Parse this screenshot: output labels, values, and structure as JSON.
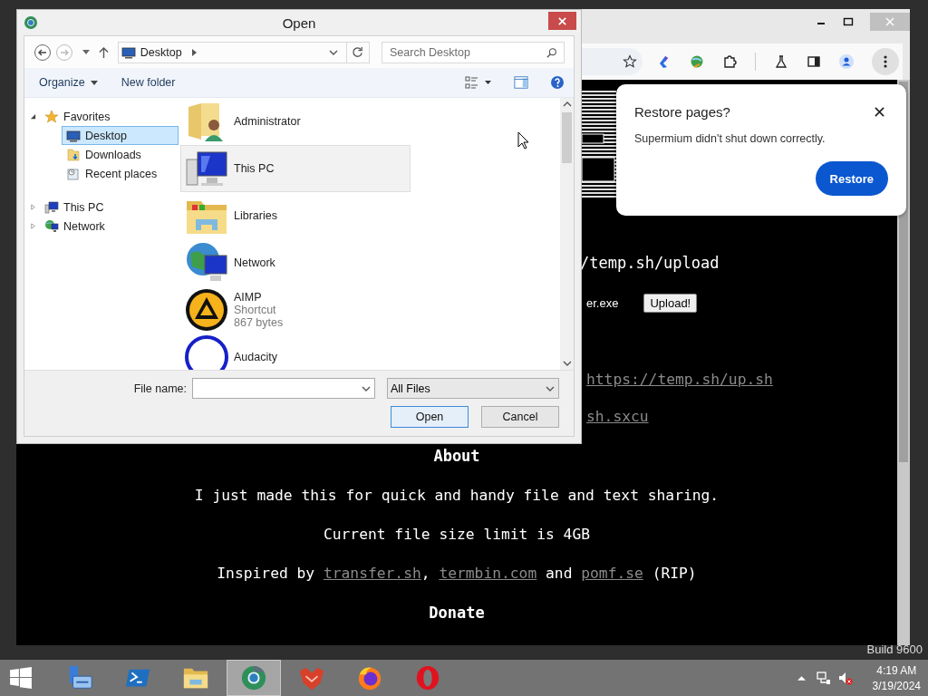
{
  "desktop": {
    "watermark": "Build 9600"
  },
  "browser": {
    "page": {
      "upload_url": "/temp.sh/upload",
      "file_name": "er.exe",
      "upload_button": "Upload!",
      "script_link": "https://temp.sh/up.sh",
      "config_link": "sh.sxcu",
      "sections": [
        {
          "kind": "heading",
          "text": "About"
        },
        {
          "kind": "text",
          "text": "I just made this for quick and handy file and text sharing."
        },
        {
          "kind": "text",
          "text": "Current file size limit is 4GB"
        },
        {
          "kind": "links",
          "parts": [
            {
              "text": "Inspired by ",
              "kind": "text"
            },
            {
              "text": "transfer.sh",
              "kind": "link"
            },
            {
              "text": ", ",
              "kind": "text"
            },
            {
              "text": "termbin.com",
              "kind": "link"
            },
            {
              "text": " and ",
              "kind": "text"
            },
            {
              "text": "pomf.se",
              "kind": "link"
            },
            {
              "text": " (RIP)",
              "kind": "text"
            }
          ]
        },
        {
          "kind": "heading",
          "text": "Donate"
        }
      ]
    },
    "restore_popup": {
      "title": "Restore pages?",
      "message": "Supermium didn't shut down correctly.",
      "button": "Restore"
    }
  },
  "dialog": {
    "title": "Open",
    "location": "Desktop",
    "search": {
      "placeholder": "Search Desktop"
    },
    "toolbar": [
      {
        "label": "Organize",
        "menu": true
      },
      {
        "label": "New folder",
        "menu": false
      }
    ],
    "navigation": [
      {
        "label": "Favorites",
        "kind": "favorites",
        "expanded": true,
        "selected": false,
        "children": [
          {
            "label": "Desktop",
            "kind": "desktop",
            "selected": true
          },
          {
            "label": "Downloads",
            "kind": "downloads",
            "selected": false
          },
          {
            "label": "Recent places",
            "kind": "recent",
            "selected": false
          }
        ]
      },
      {
        "label": "This PC",
        "kind": "pc",
        "expanded": false,
        "selected": false
      },
      {
        "label": "Network",
        "kind": "network",
        "expanded": false,
        "selected": false
      }
    ],
    "files": [
      {
        "name": "Administrator",
        "kind": "user-folder",
        "hovered": false
      },
      {
        "name": "This PC",
        "kind": "pc",
        "hovered": true
      },
      {
        "name": "Libraries",
        "kind": "libraries",
        "hovered": false
      },
      {
        "name": "Network",
        "kind": "network",
        "hovered": false
      },
      {
        "name": "AIMP",
        "kind": "aimp",
        "hovered": false,
        "details": [
          "Shortcut",
          "867 bytes"
        ]
      },
      {
        "name": "Audacity",
        "kind": "audacity",
        "hovered": false
      }
    ],
    "file_name_label": "File name:",
    "file_type": "All Files",
    "buttons": [
      {
        "label": "Open",
        "default": true
      },
      {
        "label": "Cancel",
        "default": false
      }
    ]
  },
  "taskbar": {
    "apps": [
      {
        "kind": "server-manager",
        "selected": false
      },
      {
        "kind": "powershell",
        "selected": false
      },
      {
        "kind": "explorer",
        "selected": false
      },
      {
        "kind": "supermium",
        "selected": true
      },
      {
        "kind": "fox",
        "selected": false
      },
      {
        "kind": "firefox",
        "selected": false
      },
      {
        "kind": "opera",
        "selected": false
      }
    ],
    "clock": {
      "time": "4:19 AM",
      "date": "3/19/2024"
    }
  }
}
